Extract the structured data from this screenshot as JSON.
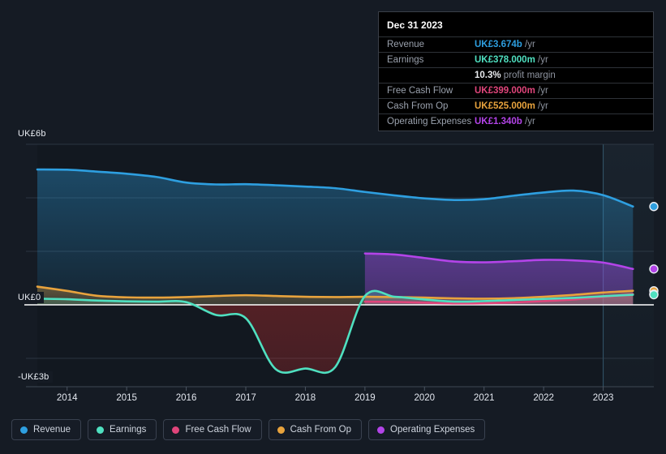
{
  "colors": {
    "revenue": "#2e9fe0",
    "earnings": "#4fe0c0",
    "free_cash_flow": "#e0457b",
    "cash_from_op": "#e8a33d",
    "operating_expenses": "#b344e8",
    "background": "#151b24",
    "zero_line": "#ffffff",
    "grid": "#2a3340"
  },
  "tooltip": {
    "date": "Dec 31 2023",
    "rows": [
      {
        "label": "Revenue",
        "value": "UK£3.674b",
        "unit": "/yr",
        "color": "#2e9fe0"
      },
      {
        "label": "Earnings",
        "value": "UK£378.000m",
        "unit": "/yr",
        "color": "#4fe0c0"
      },
      {
        "label": "",
        "value": "10.3%",
        "unit": "profit margin",
        "color": "#e9ebef"
      },
      {
        "label": "Free Cash Flow",
        "value": "UK£399.000m",
        "unit": "/yr",
        "color": "#e0457b"
      },
      {
        "label": "Cash From Op",
        "value": "UK£525.000m",
        "unit": "/yr",
        "color": "#e8a33d"
      },
      {
        "label": "Operating Expenses",
        "value": "UK£1.340b",
        "unit": "/yr",
        "color": "#b344e8"
      }
    ]
  },
  "legend": {
    "items": [
      {
        "label": "Revenue",
        "color": "#2e9fe0"
      },
      {
        "label": "Earnings",
        "color": "#4fe0c0"
      },
      {
        "label": "Free Cash Flow",
        "color": "#e0457b"
      },
      {
        "label": "Cash From Op",
        "color": "#e8a33d"
      },
      {
        "label": "Operating Expenses",
        "color": "#b344e8"
      }
    ]
  },
  "chart_data": {
    "type": "area",
    "title": "",
    "xlabel": "",
    "ylabel": "",
    "currency": "UK£",
    "units": "billions",
    "ylim": [
      -3,
      6
    ],
    "ytick_labels": [
      "UK£6b",
      "UK£0",
      "-UK£3b"
    ],
    "ytick_values": [
      6,
      0,
      -3
    ],
    "gridlines": [
      6,
      4,
      2,
      0,
      -2
    ],
    "grid": true,
    "legend_position": "bottom",
    "x": [
      2013.5,
      2014,
      2014.5,
      2015,
      2015.5,
      2016,
      2016.5,
      2017,
      2017.5,
      2018,
      2018.5,
      2019,
      2019.5,
      2020,
      2020.5,
      2021,
      2021.5,
      2022,
      2022.5,
      2023,
      2023.5
    ],
    "xtick_labels": [
      "2014",
      "2015",
      "2016",
      "2017",
      "2018",
      "2019",
      "2020",
      "2021",
      "2022",
      "2023"
    ],
    "xtick_values": [
      2014,
      2015,
      2016,
      2017,
      2018,
      2019,
      2020,
      2021,
      2022,
      2023
    ],
    "highlight_band": {
      "from": 2023.0,
      "to": 2023.85
    },
    "last_point_x": 2023.85,
    "series": [
      {
        "name": "Revenue",
        "color": "#2e9fe0",
        "values": [
          5.06,
          5.05,
          4.98,
          4.9,
          4.78,
          4.57,
          4.5,
          4.51,
          4.47,
          4.42,
          4.36,
          4.22,
          4.09,
          3.98,
          3.92,
          3.95,
          4.08,
          4.2,
          4.27,
          4.1,
          3.674
        ]
      },
      {
        "name": "Earnings",
        "color": "#4fe0c0",
        "values": [
          0.23,
          0.21,
          0.16,
          0.13,
          0.12,
          0.1,
          -0.38,
          -0.5,
          -2.4,
          -2.38,
          -2.33,
          0.33,
          0.3,
          0.2,
          0.12,
          0.14,
          0.18,
          0.22,
          0.26,
          0.32,
          0.378
        ]
      },
      {
        "name": "Free Cash Flow",
        "color": "#e0457b",
        "values": [
          null,
          null,
          null,
          null,
          null,
          null,
          null,
          null,
          null,
          null,
          null,
          0.12,
          0.11,
          0.08,
          0.05,
          0.06,
          0.09,
          0.14,
          0.2,
          0.3,
          0.399
        ]
      },
      {
        "name": "Cash From Op",
        "color": "#e8a33d",
        "values": [
          0.68,
          0.52,
          0.34,
          0.28,
          0.27,
          0.29,
          0.33,
          0.36,
          0.33,
          0.3,
          0.29,
          0.3,
          0.29,
          0.27,
          0.24,
          0.23,
          0.25,
          0.3,
          0.37,
          0.46,
          0.525
        ]
      },
      {
        "name": "Operating Expenses",
        "color": "#b344e8",
        "values": [
          null,
          null,
          null,
          null,
          null,
          null,
          null,
          null,
          null,
          null,
          null,
          1.92,
          1.88,
          1.75,
          1.62,
          1.59,
          1.63,
          1.68,
          1.66,
          1.58,
          1.34
        ]
      }
    ]
  }
}
